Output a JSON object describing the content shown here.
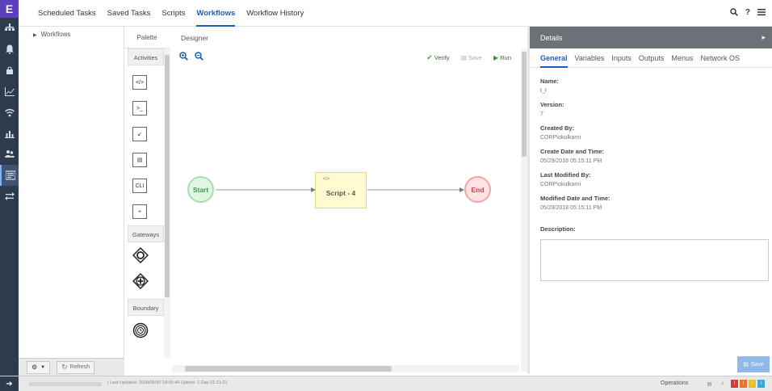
{
  "app": {
    "logo_letter": "E"
  },
  "rail": {
    "items": [
      {
        "icon": "sitemap-icon"
      },
      {
        "icon": "bell-icon"
      },
      {
        "icon": "lock-icon"
      },
      {
        "icon": "line-chart-icon"
      },
      {
        "icon": "wifi-icon"
      },
      {
        "icon": "bar-chart-icon"
      },
      {
        "icon": "users-icon"
      },
      {
        "icon": "tasks-icon",
        "active": true
      },
      {
        "icon": "exchange-icon"
      }
    ]
  },
  "tabs": [
    {
      "label": "Scheduled Tasks"
    },
    {
      "label": "Saved Tasks"
    },
    {
      "label": "Scripts"
    },
    {
      "label": "Workflows",
      "active": true
    },
    {
      "label": "Workflow History"
    }
  ],
  "topbar_icons": {
    "search": "search-icon",
    "help": "?",
    "menu": "menu-icon"
  },
  "tree": {
    "root_label": "Workflows"
  },
  "tree_toolbar": {
    "refresh_label": "Refresh"
  },
  "palette": {
    "header": "Palette",
    "sections": {
      "activities": "Activities",
      "gateways": "Gateways",
      "boundary": "Boundary"
    },
    "activity_items": [
      "</>",
      ">_",
      "↙",
      "▤",
      "CLI",
      "+"
    ]
  },
  "designer": {
    "header": "Designer",
    "toolbar": {
      "verify_label": "Verify",
      "save_label": "Save",
      "run_label": "Run"
    },
    "nodes": {
      "start_label": "Start",
      "script_icon": "</>",
      "script_label": "Script - 4",
      "end_label": "End"
    }
  },
  "details": {
    "header": "Details",
    "tabs": [
      {
        "label": "General",
        "active": true
      },
      {
        "label": "Variables"
      },
      {
        "label": "Inputs"
      },
      {
        "label": "Outputs"
      },
      {
        "label": "Menus"
      },
      {
        "label": "Network OS"
      }
    ],
    "fields": [
      {
        "label": "Name:",
        "value": "t_t"
      },
      {
        "label": "Version:",
        "value": "7"
      },
      {
        "label": "Created By:",
        "value": "CORP\\okulkarni"
      },
      {
        "label": "Create Date and Time:",
        "value": "05/29/2018 05:15:11 PM"
      },
      {
        "label": "Last Modified By:",
        "value": "CORP\\okulkarni"
      },
      {
        "label": "Modified Date and Time:",
        "value": "05/29/2018 05:15:11 PM"
      }
    ],
    "description_label": "Description:",
    "description_value": "",
    "save_label": "Save"
  },
  "statusbar": {
    "text": "| Last Updated: 2018/05/30 14:06:44   Uptime: 1 Day 01:21:21",
    "operations_label": "Operations"
  },
  "colors": {
    "rail_bg": "#2d3b4c",
    "accent": "#1a5fb4",
    "details_header": "#6c7178",
    "start_fill": "#e0f5e2",
    "end_fill": "#fde3e3",
    "script_fill": "#fffbd0"
  }
}
